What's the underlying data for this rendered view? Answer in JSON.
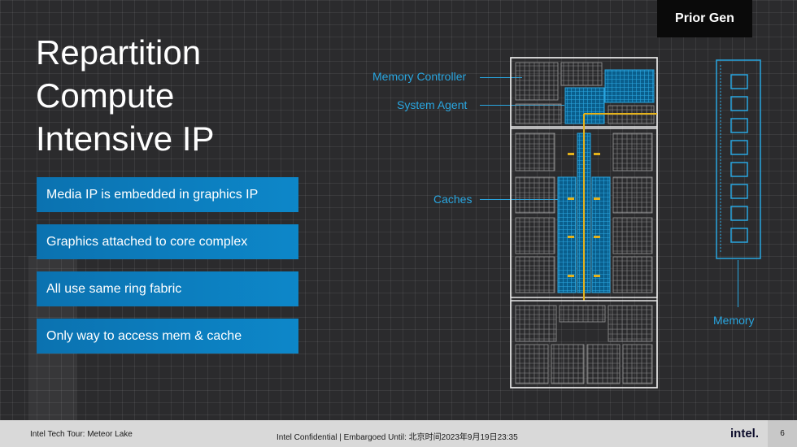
{
  "badge": "Prior Gen",
  "title_lines": [
    "Repartition",
    "Compute",
    "Intensive IP"
  ],
  "bullets": [
    "Media IP is embedded in graphics IP",
    "Graphics attached to core complex",
    "All use same ring fabric",
    "Only way to access  mem & cache"
  ],
  "callouts": {
    "memory_controller": "Memory Controller",
    "system_agent": "System Agent",
    "caches": "Caches",
    "memory": "Memory"
  },
  "footer": {
    "left": "Intel Tech Tour: Meteor Lake",
    "middle": "Intel Confidential  |  Embargoed Until: 北京时间2023年9月19日23:35",
    "logo": "intel.",
    "page": "6"
  },
  "colors": {
    "accent": "#29a6e0",
    "bullet_bg": "#0b72b0",
    "ring": "#e5b21b",
    "die_outline": "#e6e6e6"
  }
}
